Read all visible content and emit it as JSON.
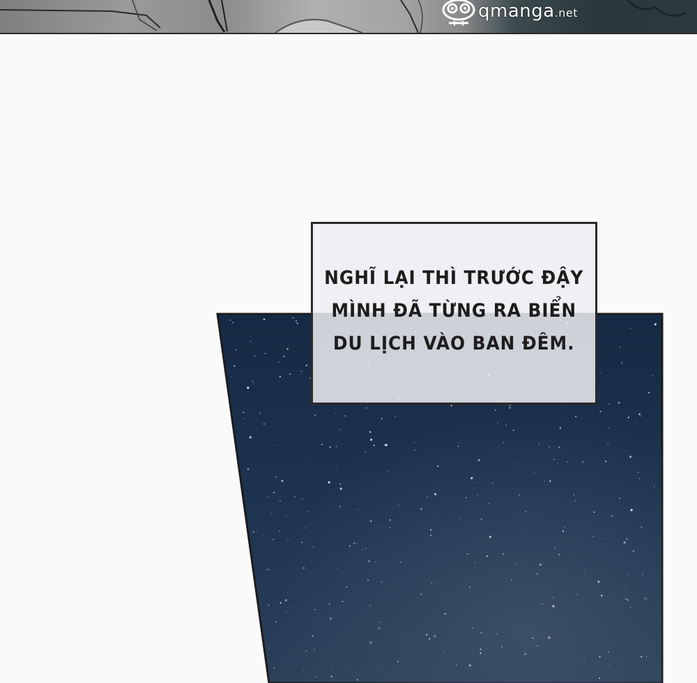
{
  "watermark": {
    "logo_icon": "owl-face-icon",
    "site_name": "qmanga",
    "site_suffix": ".net"
  },
  "narration": {
    "lines": [
      "NGHĨ LẠI THÌ TRƯỚC ĐẬY",
      "MÌNH ĐÃ TỪNG RA BIỂN",
      "DU LỊCH VÀO BAN ĐÊM."
    ]
  },
  "colors": {
    "page_background": "#fafafa",
    "sky_top": "#182b45",
    "sky_bottom": "#2b3f58",
    "panel_border": "#1c1c1c",
    "narration_fill": "#eceef1",
    "narration_text": "#1d1d1d"
  }
}
